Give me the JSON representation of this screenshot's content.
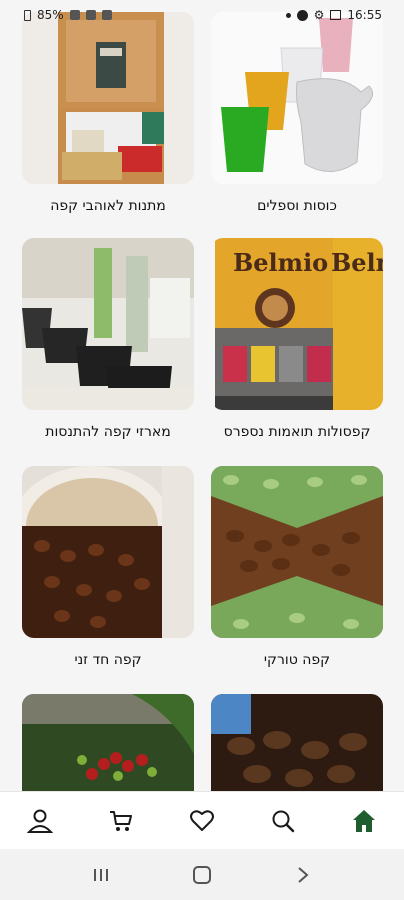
{
  "status": {
    "battery": "85%",
    "time": "16:55"
  },
  "products": [
    {
      "title": "כוסות וספלים",
      "image": "glasses-and-cups-photo"
    },
    {
      "title": "מתנות לאוהבי קפה",
      "image": "coffee-gift-box-photo"
    },
    {
      "title": "קפסולות תואמות נספרס",
      "image": "belmio-capsules-photo"
    },
    {
      "title": "מארזי קפה להתנסות",
      "image": "coffee-tasting-cups-photo"
    },
    {
      "title": "קפה טורקי",
      "image": "turkish-coffee-beans-photo"
    },
    {
      "title": "קפה חד זני",
      "image": "single-origin-beans-photo"
    },
    {
      "title": "",
      "image": "roasted-beans-photo"
    },
    {
      "title": "",
      "image": "coffee-cherries-photo"
    }
  ],
  "capsule_brand": "Belmio",
  "bottom_nav": [
    "home-icon",
    "search-icon",
    "heart-icon",
    "cart-icon",
    "user-icon"
  ],
  "colors": {
    "accent": "#1f5c2e",
    "background": "#f5f5f5"
  }
}
